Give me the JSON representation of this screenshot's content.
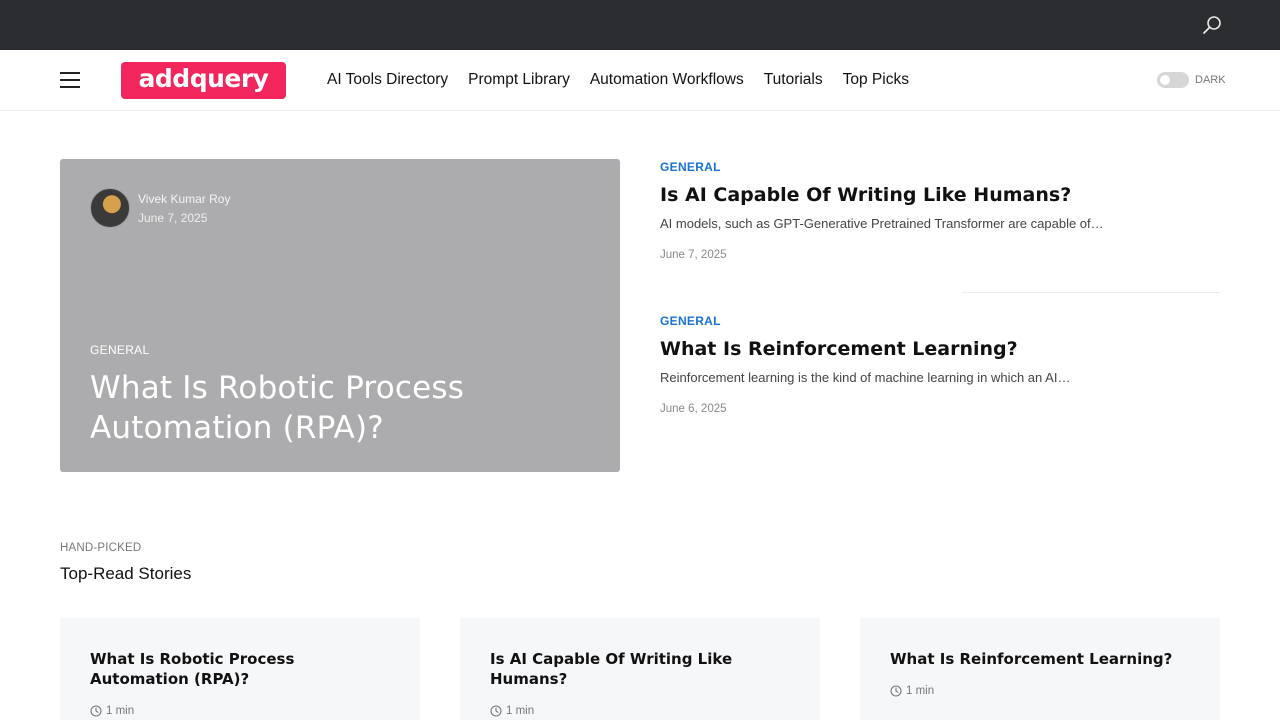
{
  "topbar": {
    "search_icon": "search-icon"
  },
  "header": {
    "menu_icon": "hamburger-menu-icon",
    "logo_text": "addquery",
    "nav": [
      {
        "label": "AI Tools Directory"
      },
      {
        "label": "Prompt Library"
      },
      {
        "label": "Automation Workflows"
      },
      {
        "label": "Tutorials"
      },
      {
        "label": "Top Picks"
      }
    ],
    "dark_mode_label": "DARK"
  },
  "hero": {
    "author": "Vivek Kumar Roy",
    "date": "June 7, 2025",
    "category": "GENERAL",
    "title": "What Is Robotic Process Automation (RPA)?"
  },
  "side_posts": [
    {
      "category": "GENERAL",
      "title": "Is AI Capable Of Writing Like Humans?",
      "excerpt": "AI models, such as GPT-Generative Pretrained Transformer are capable of…",
      "date": "June 7, 2025"
    },
    {
      "category": "GENERAL",
      "title": "What Is Reinforcement Learning?",
      "excerpt": "Reinforcement learning is the kind of machine learning in which an AI…",
      "date": "June 6, 2025"
    }
  ],
  "section": {
    "kicker": "HAND-PICKED",
    "title": "Top-Read Stories"
  },
  "cards": [
    {
      "title": "What Is Robotic Process Automation (RPA)?",
      "read_time": "1 min"
    },
    {
      "title": "Is AI Capable Of Writing Like Humans?",
      "read_time": "1 min"
    },
    {
      "title": "What Is Reinforcement Learning?",
      "read_time": "1 min"
    }
  ],
  "colors": {
    "topbar": "#2c2d31",
    "brand": "#f2255c",
    "category_link": "#1a73d4",
    "card_bg": "#f6f7f9"
  }
}
